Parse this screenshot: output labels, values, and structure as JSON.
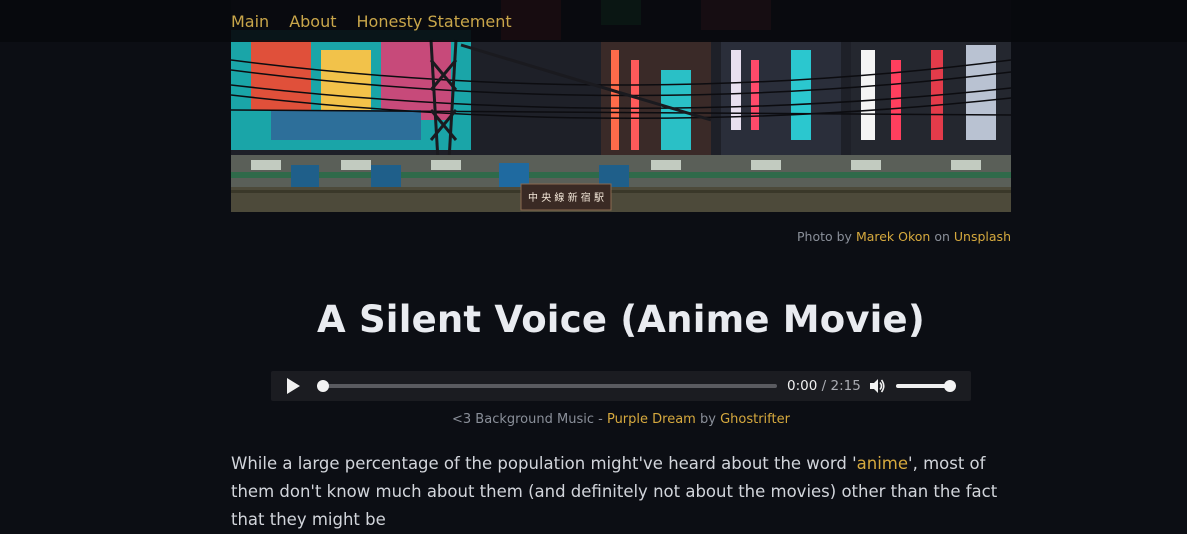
{
  "nav": {
    "items": [
      {
        "label": "Main"
      },
      {
        "label": "About"
      },
      {
        "label": "Honesty Statement"
      }
    ]
  },
  "hero": {
    "credit_prefix": "Photo by",
    "credit_author": "Marek Okon",
    "credit_middle": "on",
    "credit_source": "Unsplash",
    "sign_text": "中 央 線 新 宿 駅"
  },
  "article": {
    "title": "A Silent Voice (Anime Movie)"
  },
  "audio": {
    "current_time": "0:00",
    "separator": "/",
    "duration": "2:15",
    "progress": 0,
    "volume": 1.0
  },
  "music_caption": {
    "prefix": "<3 Background Music -",
    "track": "Purple Dream",
    "by": "by",
    "artist": "Ghostrifter"
  },
  "paragraph": {
    "before_link": "While a large percentage of the population might've heard about the word '",
    "link": "anime",
    "after_link": "', most of them don't know much about them (and definitely not about the movies) other than the fact that they might be"
  },
  "colors": {
    "background": "#0c0e14",
    "accent": "#d6a93e",
    "nav_link": "#c9a64a",
    "title": "#e9ebf0"
  }
}
